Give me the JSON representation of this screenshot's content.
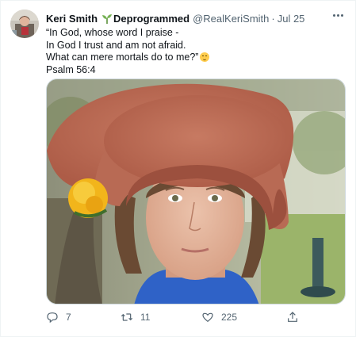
{
  "tweet": {
    "author_name": "Keri Smith",
    "author_name_suffix": "Deprogrammed",
    "handle": "@RealKeriSmith",
    "separator": "·",
    "timestamp": "Jul 25",
    "text_lines": [
      "“In God, whose word I praise -",
      "In God I trust and am not afraid.",
      "What can mere mortals do to me?”",
      "Psalm 56:4"
    ],
    "emoji": "relieved-face",
    "reply_count": "7",
    "retweet_count": "11",
    "like_count": "225"
  },
  "icons": {
    "name_badge": "seedling-icon",
    "menu": "more-dots-icon",
    "reply": "reply-icon",
    "retweet": "retweet-icon",
    "like": "heart-icon",
    "share": "share-icon"
  },
  "colors": {
    "text_primary": "#0f1419",
    "text_secondary": "#536471",
    "border": "#cfd9de",
    "divider": "#eff3f4"
  }
}
